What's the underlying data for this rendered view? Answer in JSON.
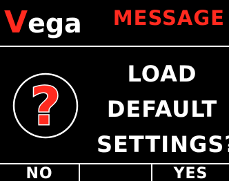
{
  "header": {
    "brand_first": "V",
    "brand_rest": "ega",
    "title": "MESSAGE"
  },
  "icon": {
    "name": "question-mark-icon",
    "glyph": "?",
    "color": "#ff2a1f",
    "ring_color": "#ffffff"
  },
  "prompt": {
    "lines": [
      "LOAD",
      "DEFAULT",
      "SETTINGS?"
    ]
  },
  "softkeys": [
    "NO",
    "",
    "YES"
  ],
  "colors": {
    "accent": "#ff2a1f",
    "background": "#000000",
    "foreground": "#ffffff"
  }
}
